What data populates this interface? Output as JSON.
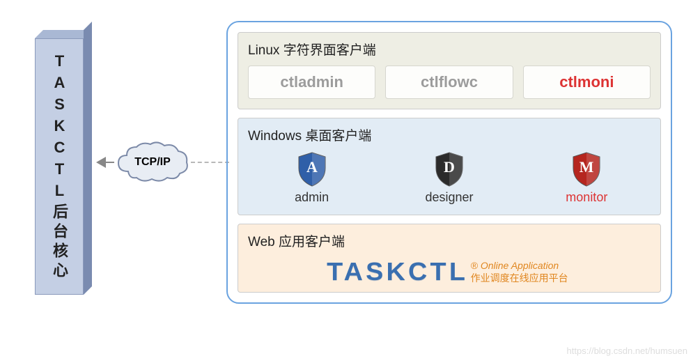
{
  "server": {
    "label": "TASKCTL后台核心"
  },
  "connector": {
    "protocol": "TCP/IP"
  },
  "sections": {
    "linux": {
      "title": "Linux 字符界面客户端",
      "items": [
        "ctladmin",
        "ctlflowc",
        "ctlmoni"
      ],
      "highlight_index": 2
    },
    "windows": {
      "title": "Windows 桌面客户端",
      "apps": [
        {
          "letter": "A",
          "label": "admin",
          "color": "#2f5fa8"
        },
        {
          "letter": "D",
          "label": "designer",
          "color": "#2b2b2b"
        },
        {
          "letter": "M",
          "label": "monitor",
          "color": "#b5261f"
        }
      ],
      "highlight_index": 2
    },
    "web": {
      "title": "Web 应用客户端",
      "logo_text": "TASKCTL",
      "sub_en": "® Online Application",
      "sub_cn": "作业调度在线应用平台"
    }
  },
  "watermark": "https://blog.csdn.net/humsuen"
}
